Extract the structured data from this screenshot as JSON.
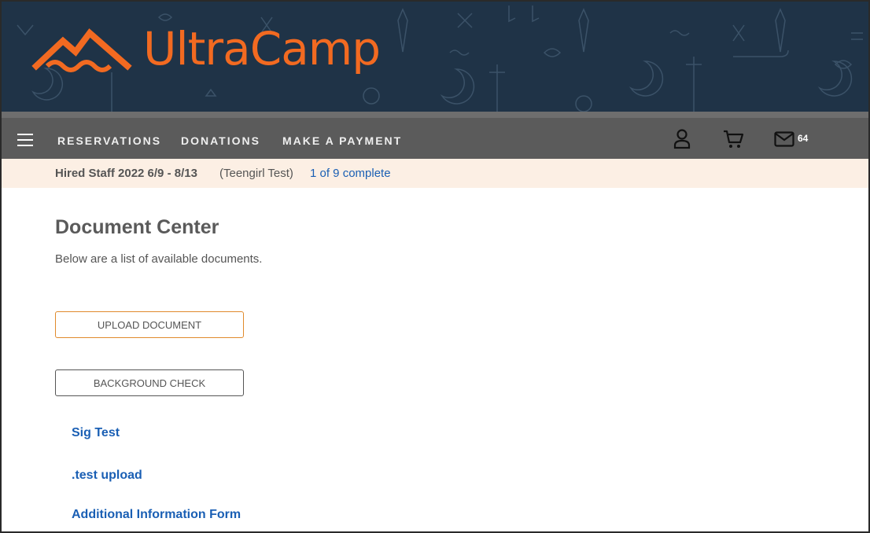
{
  "brand": {
    "name": "UltraCamp",
    "color": "#f26a21",
    "banner_color": "#1f3347"
  },
  "nav": {
    "items": [
      {
        "label": "RESERVATIONS"
      },
      {
        "label": "DONATIONS"
      },
      {
        "label": "MAKE A PAYMENT"
      }
    ],
    "icons": [
      "hamburger-menu-icon",
      "user-icon",
      "cart-icon",
      "envelope-icon"
    ],
    "message_count": "64"
  },
  "session_bar": {
    "session": "Hired Staff 2022 6/9 - 8/13",
    "person": "(Teengirl Test)",
    "progress": "1 of 9 complete"
  },
  "main": {
    "title": "Document Center",
    "subtitle": "Below are a list of available documents.",
    "upload_button": "UPLOAD DOCUMENT",
    "background_button": "BACKGROUND CHECK",
    "documents": [
      {
        "label": "Sig Test"
      },
      {
        "label": ".test upload"
      },
      {
        "label": "Additional Information Form"
      }
    ]
  }
}
